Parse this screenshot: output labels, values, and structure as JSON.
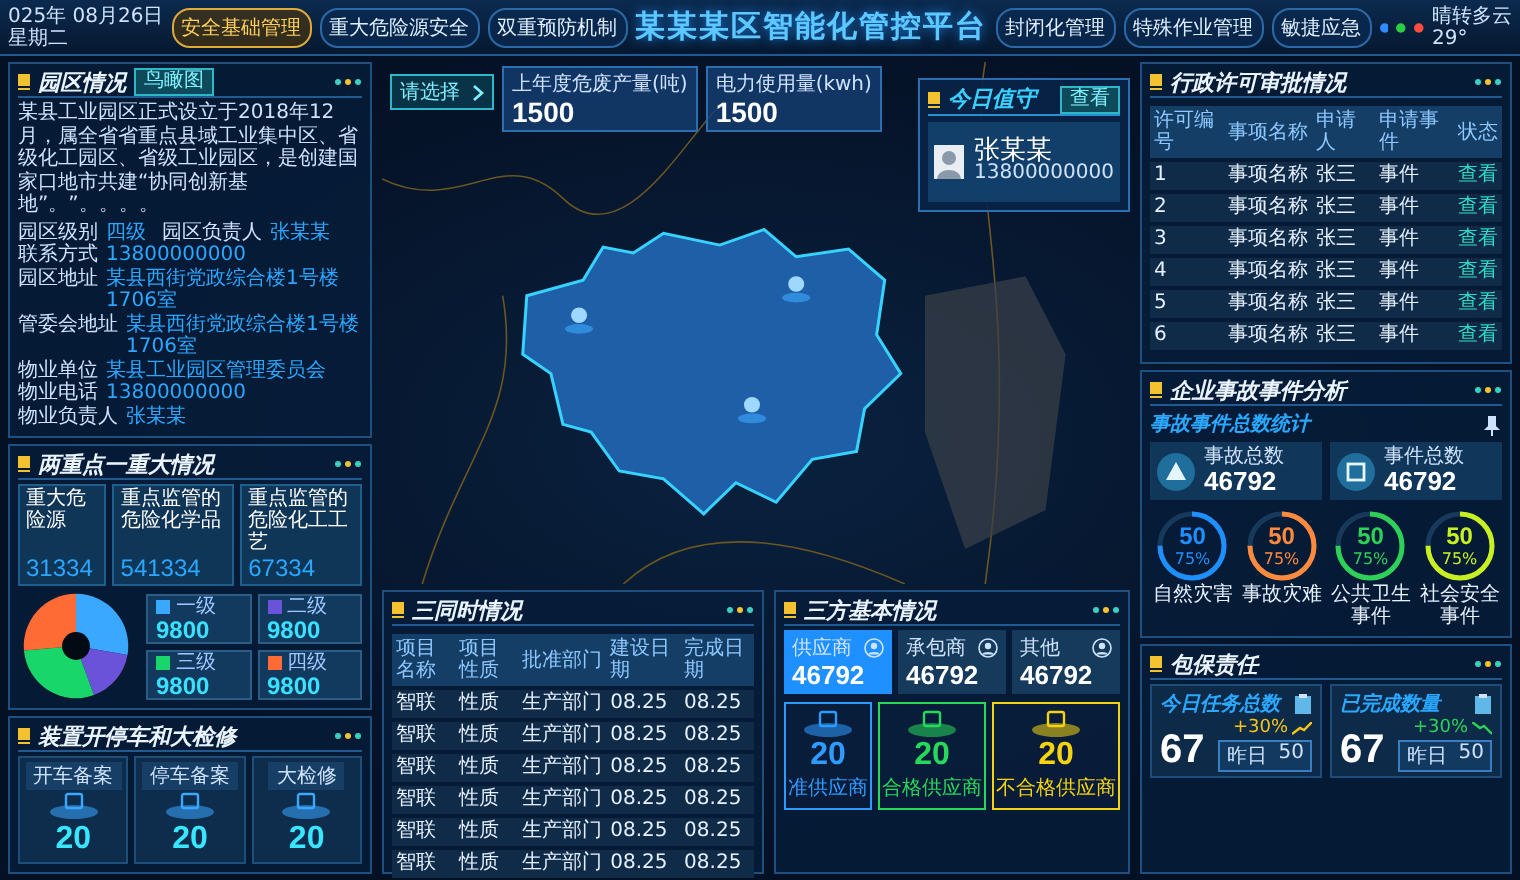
{
  "top_bar": {
    "date": "025年 08月26日",
    "weekday": "星期二",
    "title": "某某某区智能化管控平台",
    "nav_left": [
      {
        "label": "安全基础管理",
        "selected": true
      },
      {
        "label": "重大危险源安全",
        "selected": false
      },
      {
        "label": "双重预防机制",
        "selected": false
      }
    ],
    "nav_right": [
      {
        "label": "封闭化管理",
        "selected": false
      },
      {
        "label": "特殊作业管理",
        "selected": false
      },
      {
        "label": "敏捷应急",
        "selected": false
      }
    ],
    "weather": {
      "indicators": [
        {
          "color": "#2f8cff"
        },
        {
          "color": "#2ecc40"
        },
        {
          "color": "#ff4d3d"
        }
      ],
      "text": "晴转多云",
      "temperature": "29°"
    }
  },
  "park": {
    "title": "园区情况",
    "tag": "鸟瞰图",
    "description": "某县工业园区正式设立于2018年12月，属全省省重点县域工业集中区、省级化工园区、省级工业园区，是创建国家口地市共建“协同创新基地”。”。。。。",
    "fields": [
      {
        "label": "园区级别",
        "value": "四级"
      },
      {
        "label": "园区负责人",
        "value": "张某某"
      },
      {
        "label": "联系方式",
        "value": "13800000000"
      },
      {
        "label": "园区地址",
        "value": "某县西街党政综合楼1号楼1706室"
      },
      {
        "label": "管委会地址",
        "value": "某县西街党政综合楼1号楼1706室"
      },
      {
        "label": "物业单位",
        "value": "某县工业园区管理委员会"
      },
      {
        "label": "物业电话",
        "value": "13800000000"
      },
      {
        "label": "物业负责人",
        "value": "张某某"
      }
    ]
  },
  "two_key": {
    "title": "两重点一重大情况",
    "stats": [
      {
        "label": "重大危险源",
        "value": "31334"
      },
      {
        "label": "重点监管的危险化学品",
        "value": "541334"
      },
      {
        "label": "重点监管的危险化工工艺",
        "value": "67334"
      }
    ],
    "levels": [
      {
        "label": "一级",
        "value": "9800",
        "color": "#3aa8ff"
      },
      {
        "label": "二级",
        "value": "9800",
        "color": "#6a52d9"
      },
      {
        "label": "三级",
        "value": "9800",
        "color": "#19d66b"
      },
      {
        "label": "四级",
        "value": "9800",
        "color": "#ff6b35"
      }
    ]
  },
  "devices": {
    "title": "装置开停车和大检修",
    "items": [
      {
        "label": "开车备案",
        "value": "20"
      },
      {
        "label": "停车备案",
        "value": "20"
      },
      {
        "label": "大检修",
        "value": "20"
      }
    ]
  },
  "map": {
    "select_button": "请选择",
    "stats": [
      {
        "label": "上年度危废产量(吨)",
        "value": "1500"
      },
      {
        "label": "电力使用量(kwh)",
        "value": "1500"
      }
    ],
    "duty": {
      "title": "今日值守",
      "action": "查看",
      "name": "张某某",
      "phone": "13800000000"
    }
  },
  "three_simultaneous": {
    "title": "三同时情况",
    "columns": [
      "项目名称",
      "项目性质",
      "批准部门",
      "建设日期",
      "完成日期"
    ],
    "rows": [
      [
        "智联",
        "性质",
        "生产部门",
        "08.25",
        "08.25"
      ],
      [
        "智联",
        "性质",
        "生产部门",
        "08.25",
        "08.25"
      ],
      [
        "智联",
        "性质",
        "生产部门",
        "08.25",
        "08.25"
      ],
      [
        "智联",
        "性质",
        "生产部门",
        "08.25",
        "08.25"
      ],
      [
        "智联",
        "性质",
        "生产部门",
        "08.25",
        "08.25"
      ],
      [
        "智联",
        "性质",
        "生产部门",
        "08.25",
        "08.25"
      ]
    ]
  },
  "three_party": {
    "title": "三方基本情况",
    "parties": [
      {
        "label": "供应商",
        "value": "46792",
        "selected": true
      },
      {
        "label": "承包商",
        "value": "46792",
        "selected": false
      },
      {
        "label": "其他",
        "value": "46792",
        "selected": false
      }
    ],
    "grades": [
      {
        "value": "20",
        "label": "准供应商",
        "color": "#2f9bff"
      },
      {
        "value": "20",
        "label": "合格供应商",
        "color": "#27d85a"
      },
      {
        "value": "20",
        "label": "不合格供应商",
        "color": "#f5d311"
      }
    ]
  },
  "permits": {
    "title": "行政许可审批情况",
    "columns": [
      "许可编号",
      "事项名称",
      "申请人",
      "申请事件",
      "状态"
    ],
    "rows": [
      {
        "cells": [
          "1",
          "事项名称",
          "张三",
          "事件"
        ],
        "action": "查看"
      },
      {
        "cells": [
          "2",
          "事项名称",
          "张三",
          "事件"
        ],
        "action": "查看"
      },
      {
        "cells": [
          "3",
          "事项名称",
          "张三",
          "事件"
        ],
        "action": "查看"
      },
      {
        "cells": [
          "4",
          "事项名称",
          "张三",
          "事件"
        ],
        "action": "查看"
      },
      {
        "cells": [
          "5",
          "事项名称",
          "张三",
          "事件"
        ],
        "action": "查看"
      },
      {
        "cells": [
          "6",
          "事项名称",
          "张三",
          "事件"
        ],
        "action": "查看"
      }
    ]
  },
  "incidents": {
    "title": "企业事故事件分析",
    "subtitle": "事故事件总数统计",
    "totals": [
      {
        "kind": "accident",
        "label": "事故总数",
        "value": "46792"
      },
      {
        "kind": "event",
        "label": "事件总数",
        "value": "46792"
      }
    ],
    "categories": [
      {
        "value": "50",
        "percent": "75%",
        "label": "自然灾害",
        "color": "#1e8fff",
        "level": 0.75
      },
      {
        "value": "50",
        "percent": "75%",
        "label": "事故灾难",
        "color": "#ff8a3d",
        "level": 0.75
      },
      {
        "value": "50",
        "percent": "75%",
        "label": "公共卫生事件",
        "color": "#2ed158",
        "level": 0.75
      },
      {
        "value": "50",
        "percent": "75%",
        "label": "社会安全事件",
        "color": "#c8f020",
        "level": 0.75
      }
    ]
  },
  "guarantee": {
    "title": "包保责任",
    "cards": [
      {
        "title": "今日任务总数",
        "value": "67",
        "change": "+30%",
        "kind": "rise",
        "yesterday_label": "昨日",
        "yesterday_value": "50"
      },
      {
        "title": "已完成数量",
        "value": "67",
        "change": "+30%",
        "kind": "fall",
        "yesterday_label": "昨日",
        "yesterday_value": "50"
      }
    ]
  }
}
